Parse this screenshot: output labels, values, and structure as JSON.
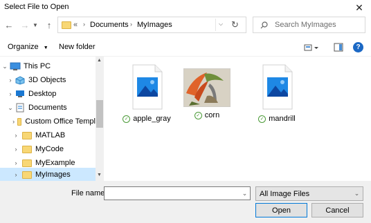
{
  "window": {
    "title": "Select File to Open"
  },
  "nav": {
    "address": {
      "overflow": "«",
      "segments": [
        "Documents",
        "MyImages"
      ]
    },
    "search_placeholder": "Search MyImages"
  },
  "toolbar": {
    "organize_label": "Organize",
    "new_folder_label": "New folder"
  },
  "tree": [
    {
      "label": "This PC",
      "icon": "computer-icon",
      "expanded": true
    },
    {
      "label": "3D Objects",
      "icon": "3d-objects-icon"
    },
    {
      "label": "Desktop",
      "icon": "desktop-icon"
    },
    {
      "label": "Documents",
      "icon": "documents-icon",
      "expanded": true
    },
    {
      "label": "Custom Office Templ",
      "icon": "folder-icon"
    },
    {
      "label": "MATLAB",
      "icon": "folder-icon"
    },
    {
      "label": "MyCode",
      "icon": "folder-icon"
    },
    {
      "label": "MyExample",
      "icon": "folder-icon"
    },
    {
      "label": "MyImages",
      "icon": "folder-icon",
      "selected": true
    }
  ],
  "files": [
    {
      "name": "apple_gray",
      "thumbnail": "image-file-icon",
      "status": "synced"
    },
    {
      "name": "corn",
      "thumbnail": "corn-thumbnail",
      "status": "synced"
    },
    {
      "name": "mandrill",
      "thumbnail": "image-file-icon",
      "status": "synced"
    }
  ],
  "bottom": {
    "file_name_label": "File name:",
    "file_name_value": "",
    "filter_value": "All Image Files",
    "open_label": "Open",
    "cancel_label": "Cancel"
  },
  "colors": {
    "accent": "#0078d7",
    "selection": "#cce8ff",
    "folder": "#f8d775",
    "sync_check": "#4a9a36"
  }
}
